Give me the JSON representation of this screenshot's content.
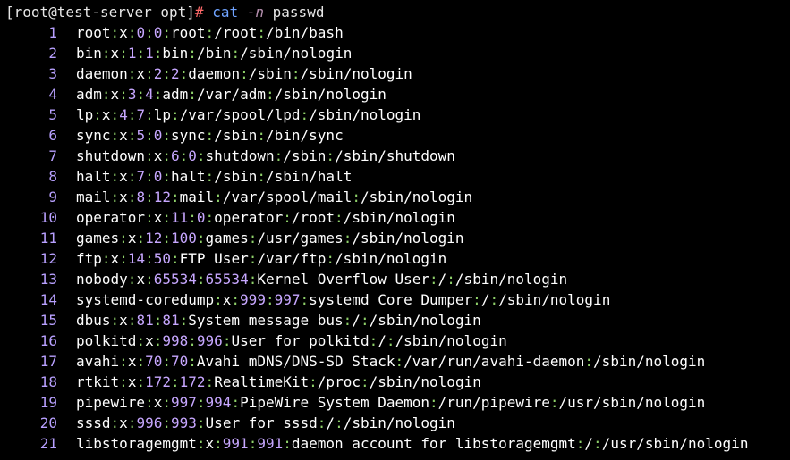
{
  "terminal": {
    "prompt": "[root@test-server opt]",
    "prompt_symbol": "#",
    "command": "cat",
    "flag": "-n",
    "argument": "passwd",
    "colors": {
      "background": "#000000",
      "line_number": "#b8a0ff",
      "separator": "#8fd16a",
      "numeric_field": "#c7a7ff",
      "prompt_symbol": "#ff6a6a",
      "command": "#6fa3ff"
    }
  },
  "lines": [
    {
      "n": "1",
      "user": "root",
      "x": "x",
      "uid": "0",
      "gid": "0",
      "gecos": "root",
      "home": "/root",
      "shell": "/bin/bash"
    },
    {
      "n": "2",
      "user": "bin",
      "x": "x",
      "uid": "1",
      "gid": "1",
      "gecos": "bin",
      "home": "/bin",
      "shell": "/sbin/nologin"
    },
    {
      "n": "3",
      "user": "daemon",
      "x": "x",
      "uid": "2",
      "gid": "2",
      "gecos": "daemon",
      "home": "/sbin",
      "shell": "/sbin/nologin"
    },
    {
      "n": "4",
      "user": "adm",
      "x": "x",
      "uid": "3",
      "gid": "4",
      "gecos": "adm",
      "home": "/var/adm",
      "shell": "/sbin/nologin"
    },
    {
      "n": "5",
      "user": "lp",
      "x": "x",
      "uid": "4",
      "gid": "7",
      "gecos": "lp",
      "home": "/var/spool/lpd",
      "shell": "/sbin/nologin"
    },
    {
      "n": "6",
      "user": "sync",
      "x": "x",
      "uid": "5",
      "gid": "0",
      "gecos": "sync",
      "home": "/sbin",
      "shell": "/bin/sync"
    },
    {
      "n": "7",
      "user": "shutdown",
      "x": "x",
      "uid": "6",
      "gid": "0",
      "gecos": "shutdown",
      "home": "/sbin",
      "shell": "/sbin/shutdown"
    },
    {
      "n": "8",
      "user": "halt",
      "x": "x",
      "uid": "7",
      "gid": "0",
      "gecos": "halt",
      "home": "/sbin",
      "shell": "/sbin/halt"
    },
    {
      "n": "9",
      "user": "mail",
      "x": "x",
      "uid": "8",
      "gid": "12",
      "gecos": "mail",
      "home": "/var/spool/mail",
      "shell": "/sbin/nologin"
    },
    {
      "n": "10",
      "user": "operator",
      "x": "x",
      "uid": "11",
      "gid": "0",
      "gecos": "operator",
      "home": "/root",
      "shell": "/sbin/nologin"
    },
    {
      "n": "11",
      "user": "games",
      "x": "x",
      "uid": "12",
      "gid": "100",
      "gecos": "games",
      "home": "/usr/games",
      "shell": "/sbin/nologin"
    },
    {
      "n": "12",
      "user": "ftp",
      "x": "x",
      "uid": "14",
      "gid": "50",
      "gecos": "FTP User",
      "home": "/var/ftp",
      "shell": "/sbin/nologin"
    },
    {
      "n": "13",
      "user": "nobody",
      "x": "x",
      "uid": "65534",
      "gid": "65534",
      "gecos": "Kernel Overflow User",
      "home": "/",
      "shell": "/sbin/nologin"
    },
    {
      "n": "14",
      "user": "systemd-coredump",
      "x": "x",
      "uid": "999",
      "gid": "997",
      "gecos": "systemd Core Dumper",
      "home": "/",
      "shell": "/sbin/nologin"
    },
    {
      "n": "15",
      "user": "dbus",
      "x": "x",
      "uid": "81",
      "gid": "81",
      "gecos": "System message bus",
      "home": "/",
      "shell": "/sbin/nologin"
    },
    {
      "n": "16",
      "user": "polkitd",
      "x": "x",
      "uid": "998",
      "gid": "996",
      "gecos": "User for polkitd",
      "home": "/",
      "shell": "/sbin/nologin"
    },
    {
      "n": "17",
      "user": "avahi",
      "x": "x",
      "uid": "70",
      "gid": "70",
      "gecos": "Avahi mDNS/DNS-SD Stack",
      "home": "/var/run/avahi-daemon",
      "shell": "/sbin/nologin"
    },
    {
      "n": "18",
      "user": "rtkit",
      "x": "x",
      "uid": "172",
      "gid": "172",
      "gecos": "RealtimeKit",
      "home": "/proc",
      "shell": "/sbin/nologin"
    },
    {
      "n": "19",
      "user": "pipewire",
      "x": "x",
      "uid": "997",
      "gid": "994",
      "gecos": "PipeWire System Daemon",
      "home": "/run/pipewire",
      "shell": "/usr/sbin/nologin"
    },
    {
      "n": "20",
      "user": "sssd",
      "x": "x",
      "uid": "996",
      "gid": "993",
      "gecos": "User for sssd",
      "home": "/",
      "shell": "/sbin/nologin"
    },
    {
      "n": "21",
      "user": "libstoragemgmt",
      "x": "x",
      "uid": "991",
      "gid": "991",
      "gecos": "daemon account for libstoragemgmt",
      "home": "/",
      "shell": "/usr/sbin/nologin"
    }
  ]
}
